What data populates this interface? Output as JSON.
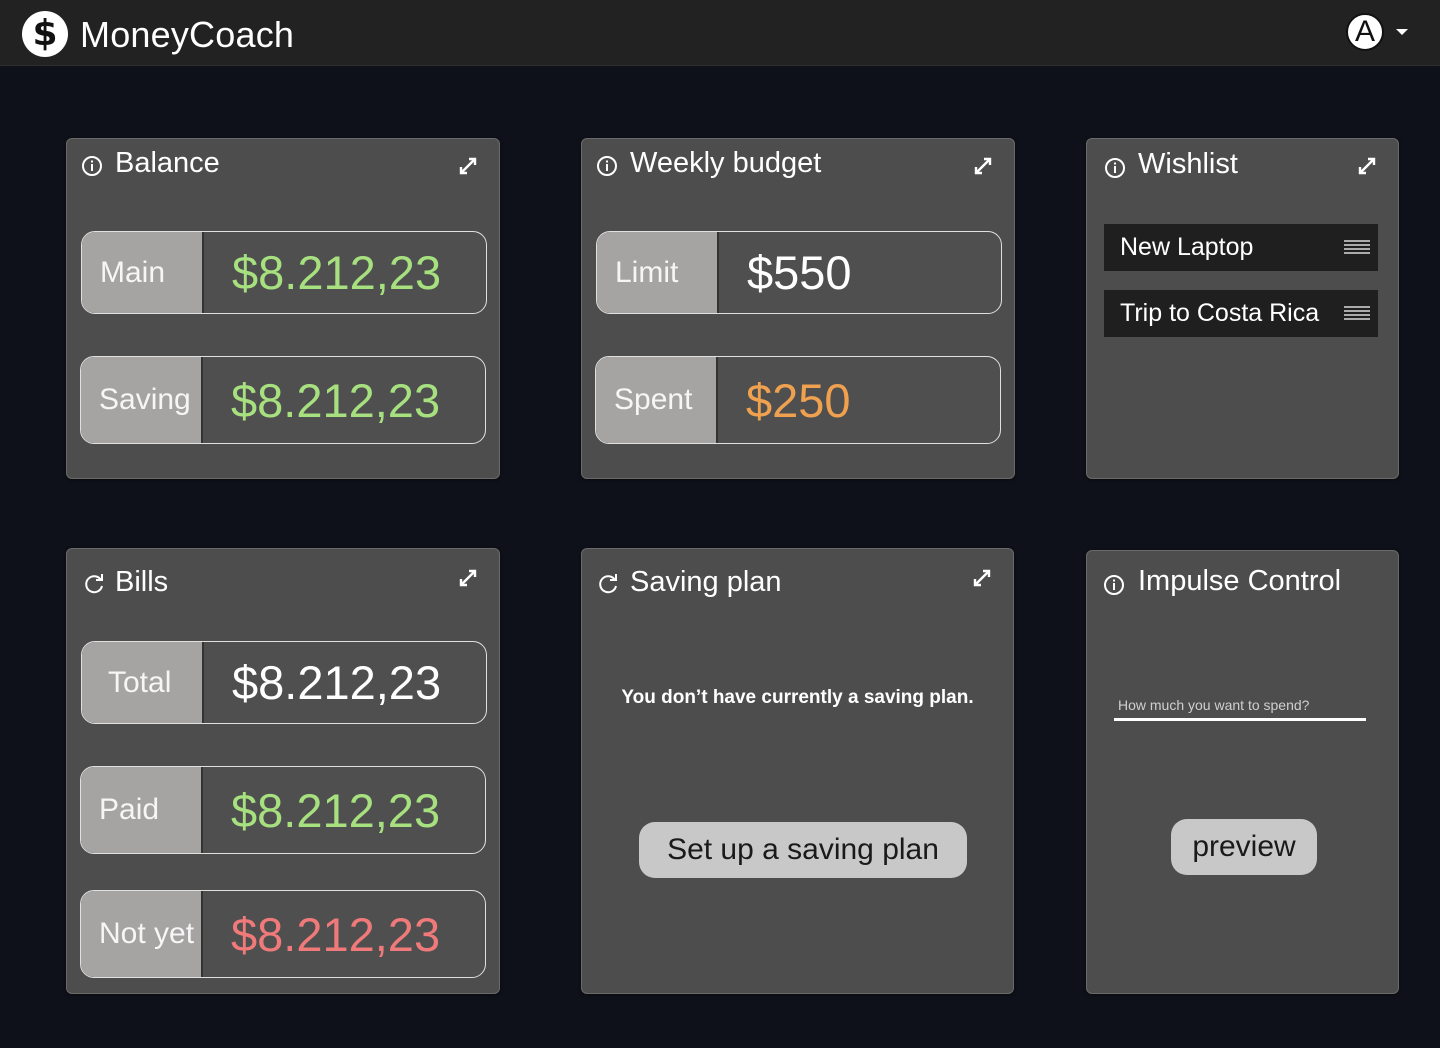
{
  "app": {
    "name": "MoneyCoach",
    "logo_glyph": "$",
    "avatar_initial": "A"
  },
  "colors": {
    "positive": "#a7e07f",
    "warning": "#f0a14f",
    "negative": "#f07a7a"
  },
  "balance": {
    "title": "Balance",
    "rows": [
      {
        "label": "Main",
        "value": "$8.212,23"
      },
      {
        "label": "Saving",
        "value": "$8.212,23"
      }
    ]
  },
  "weekly_budget": {
    "title": "Weekly budget",
    "rows": [
      {
        "label": "Limit",
        "value": "$550"
      },
      {
        "label": "Spent",
        "value": "$250"
      }
    ]
  },
  "wishlist": {
    "title": "Wishlist",
    "items": [
      {
        "label": "New Laptop"
      },
      {
        "label": "Trip to Costa Rica"
      }
    ]
  },
  "bills": {
    "title": "Bills",
    "rows": [
      {
        "label": "Total",
        "value": "$8.212,23"
      },
      {
        "label": "Paid",
        "value": "$8.212,23"
      },
      {
        "label": "Not yet",
        "value": "$8.212,23"
      }
    ]
  },
  "saving_plan": {
    "title": "Saving plan",
    "message": "You don’t have currently a saving plan.",
    "button_label": "Set up a saving plan"
  },
  "impulse_control": {
    "title": "Impulse Control",
    "input_placeholder": "How much you want to spend?",
    "input_value": "",
    "button_label": "preview"
  }
}
